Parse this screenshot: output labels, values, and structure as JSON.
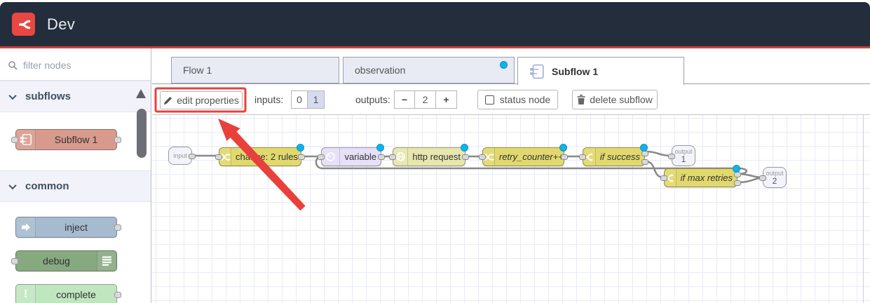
{
  "header": {
    "title": "Dev"
  },
  "palette": {
    "filter_placeholder": "filter nodes",
    "sections": [
      {
        "label": "subflows",
        "items": [
          {
            "label": "Subflow 1"
          }
        ]
      },
      {
        "label": "common",
        "items": [
          {
            "label": "inject"
          },
          {
            "label": "debug"
          },
          {
            "label": "complete"
          }
        ]
      }
    ]
  },
  "tabs": [
    {
      "label": "Flow 1"
    },
    {
      "label": "observation",
      "modified": true
    },
    {
      "label": "Subflow 1",
      "active": true
    }
  ],
  "toolbar": {
    "edit_properties": "edit properties",
    "inputs_label": "inputs:",
    "input_options": [
      "0",
      "1"
    ],
    "selected_input": "1",
    "outputs_label": "outputs:",
    "minus": "−",
    "outputs_value": "2",
    "plus": "+",
    "status_node": "status node",
    "delete_subflow": "delete subflow"
  },
  "flow": {
    "input_label": "input",
    "nodes": {
      "change": {
        "label": "change: 2 rules"
      },
      "variable": {
        "label": "variable"
      },
      "http": {
        "label": "http request"
      },
      "retry": {
        "label": "retry_counter++"
      },
      "if_success": {
        "label": "if success"
      },
      "if_max": {
        "label": "if max retries"
      }
    },
    "outputs": [
      {
        "caption": "output",
        "number": "1"
      },
      {
        "caption": "output",
        "number": "2"
      }
    ]
  },
  "colors": {
    "header_bg": "#232d3b",
    "logo_red": "#e84743",
    "accent_red": "#cf3f38",
    "annotation_red": "#e8413c",
    "modified_dot": "#0fb3ea",
    "node_yellow": "#e2d96e",
    "node_lavender": "#e6e0f8",
    "node_pale_yellow": "#e7e7ae",
    "subflow_node": "#d79a8d",
    "inject_node": "#a6bbcf",
    "debug_node": "#87a980",
    "complete_node": "#c0e6c0",
    "wire": "#888888"
  }
}
